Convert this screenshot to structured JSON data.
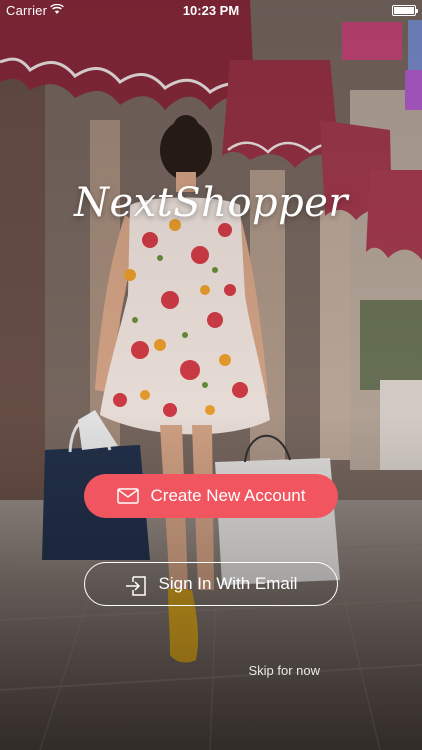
{
  "status_bar": {
    "carrier": "Carrier",
    "time": "10:23 PM",
    "wifi_icon": "wifi-icon",
    "battery_icon": "battery-icon"
  },
  "brand": {
    "logo_text": "NextShopper"
  },
  "actions": {
    "create_account_label": "Create New Account",
    "create_account_icon": "mail-icon",
    "sign_in_label": "Sign In With Email",
    "sign_in_icon": "sign-in-icon",
    "skip_label": "Skip for now"
  },
  "theme": {
    "accent": "#f05560"
  }
}
